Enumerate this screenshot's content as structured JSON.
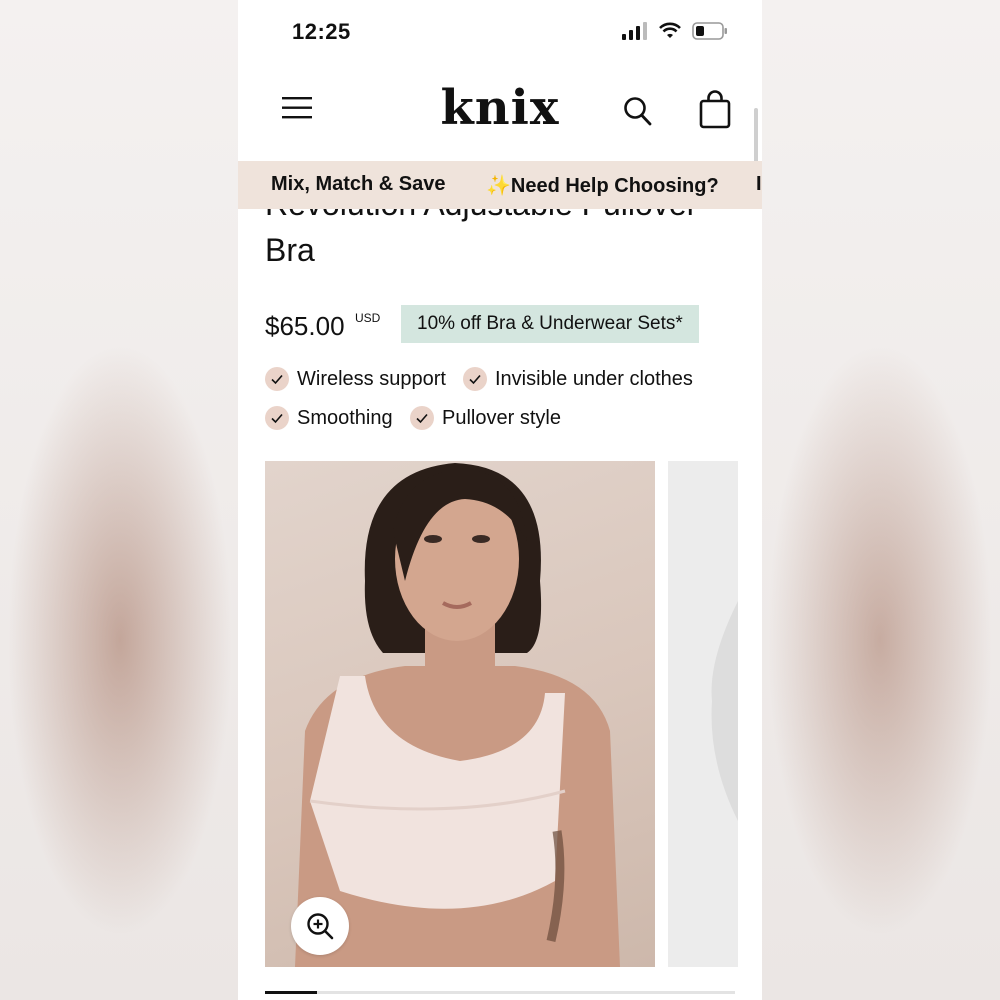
{
  "status_bar": {
    "time": "12:25"
  },
  "header": {
    "logo": "knix"
  },
  "promo": {
    "items": [
      "Mix, Match & Save",
      "✨Need Help Choosing?",
      "I"
    ]
  },
  "product": {
    "title": "Revolution Adjustable Pullover Bra",
    "price": "$65.00",
    "currency": "USD",
    "offer_badge": "10% off Bra & Underwear Sets*",
    "features": [
      "Wireless support",
      "Invisible under clothes",
      "Smoothing",
      "Pullover style"
    ]
  },
  "gallery": {
    "progress": 0.11
  },
  "colors": {
    "promo_bg": "#efe3db",
    "badge_bg": "#d4e6df",
    "check_bg": "#ead3c9"
  },
  "icons": [
    "signal-icon",
    "wifi-icon",
    "battery-icon",
    "menu-icon",
    "search-icon",
    "bag-icon",
    "check-icon",
    "zoom-in-icon"
  ]
}
